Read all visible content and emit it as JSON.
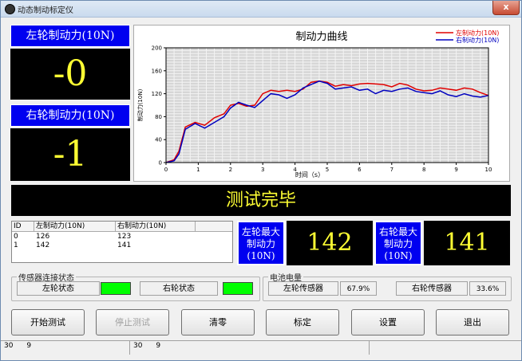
{
  "window": {
    "title": "动态制动标定仪",
    "close_symbol": "x"
  },
  "left_panel": {
    "label": "左轮制动力(10N)",
    "value": "-0"
  },
  "right_panel": {
    "label": "右轮制动力(10N)",
    "value": "-1"
  },
  "status_message": "测试完毕",
  "chart_data": {
    "type": "line",
    "title": "制动力曲线",
    "xlabel": "时间（s）",
    "ylabel": "制动力(10N)",
    "xlim": [
      0,
      10
    ],
    "ylim": [
      0,
      200
    ],
    "x_ticks": [
      "0",
      "1",
      "2",
      "3",
      "4",
      "5",
      "6",
      "7",
      "8",
      "9",
      "10"
    ],
    "y_ticks": [
      "0",
      "40",
      "80",
      "120",
      "160",
      "200"
    ],
    "grid": true,
    "legend_position": "top-right",
    "x": [
      0,
      0.25,
      0.4,
      0.6,
      0.9,
      1.2,
      1.5,
      1.8,
      2.0,
      2.25,
      2.5,
      2.75,
      3.0,
      3.25,
      3.5,
      3.75,
      4.0,
      4.25,
      4.5,
      4.75,
      5.0,
      5.25,
      5.5,
      5.75,
      6.0,
      6.25,
      6.5,
      6.75,
      7.0,
      7.25,
      7.5,
      7.75,
      8.0,
      8.25,
      8.5,
      8.75,
      9.0,
      9.25,
      9.5,
      9.75,
      10.0
    ],
    "series": [
      {
        "name": "左制动力(10N)",
        "color": "#e00000",
        "values": [
          0,
          5,
          20,
          62,
          70,
          65,
          78,
          85,
          100,
          103,
          98,
          100,
          120,
          126,
          124,
          126,
          124,
          128,
          140,
          142,
          140,
          133,
          136,
          134,
          137,
          138,
          137,
          136,
          132,
          138,
          135,
          128,
          125,
          126,
          130,
          128,
          126,
          130,
          128,
          122,
          117
        ]
      },
      {
        "name": "右制动力(10N)",
        "color": "#0000c0",
        "values": [
          0,
          3,
          15,
          58,
          68,
          60,
          70,
          80,
          95,
          105,
          100,
          96,
          108,
          120,
          118,
          112,
          118,
          130,
          136,
          142,
          138,
          128,
          130,
          132,
          126,
          128,
          120,
          126,
          124,
          128,
          130,
          124,
          122,
          120,
          125,
          118,
          115,
          120,
          116,
          114,
          117
        ]
      }
    ]
  },
  "table": {
    "columns": [
      "ID",
      "左制动力(10N)",
      "右制动力(10N)"
    ],
    "rows": [
      [
        "0",
        "126",
        "123"
      ],
      [
        "1",
        "142",
        "141"
      ]
    ]
  },
  "left_max": {
    "label_line1": "左轮最大",
    "label_line2": "制动力",
    "label_line3": "(10N)",
    "value": "142"
  },
  "right_max": {
    "label_line1": "右轮最大",
    "label_line2": "制动力",
    "label_line3": "(10N)",
    "value": "141"
  },
  "sensor_group": {
    "title": "传感器连接状态",
    "left_label": "左轮状态",
    "right_label": "右轮状态",
    "status_color": "#00ff00"
  },
  "battery_group": {
    "title": "电池电量",
    "left_label": "左轮传感器",
    "left_value": "67.9%",
    "right_label": "右轮传感器",
    "right_value": "33.6%"
  },
  "buttons": {
    "start": "开始测试",
    "stop": "停止测试",
    "zero": "清零",
    "calibrate": "标定",
    "settings": "设置",
    "exit": "退出"
  },
  "statusbar": {
    "seg1_a": "30",
    "seg1_b": "9",
    "seg2_a": "30",
    "seg2_b": "9"
  }
}
